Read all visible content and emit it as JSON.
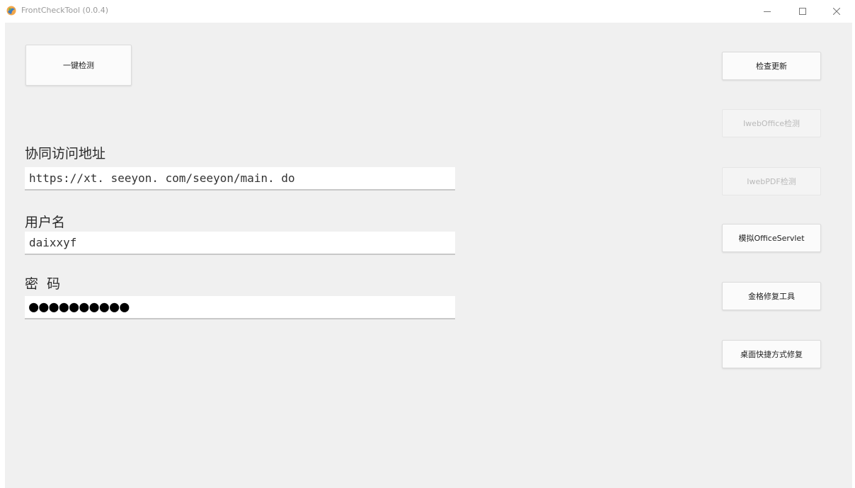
{
  "window": {
    "title": "FrontCheckTool (0.0.4)"
  },
  "main": {
    "one_click_button": "一键检测",
    "url_label": "协同访问地址",
    "url_value": "https://xt. seeyon. com/seeyon/main. do",
    "username_label": "用户名",
    "username_value": "daixxyf",
    "password_label": "密  码",
    "password_value": "●●●●●●●●●●"
  },
  "side": {
    "buttons": [
      {
        "label": "检查更新",
        "enabled": true
      },
      {
        "label": "IwebOffice检测",
        "enabled": false
      },
      {
        "label": "IwebPDF检测",
        "enabled": false
      },
      {
        "label": "模拟OfficeServlet",
        "enabled": true
      },
      {
        "label": "金格修复工具",
        "enabled": true
      },
      {
        "label": "桌面快捷方式修复",
        "enabled": true
      }
    ]
  },
  "colors": {
    "content_bg": "#f0f0f0",
    "disabled_text": "#b9b9b9"
  }
}
